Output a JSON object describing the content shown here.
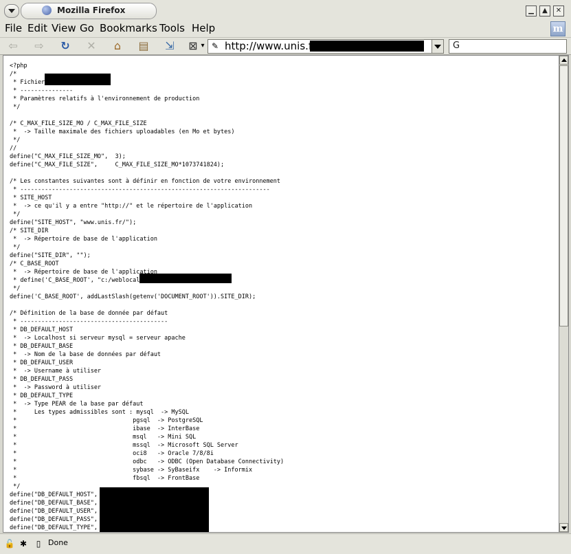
{
  "window": {
    "title": "Mozilla Firefox",
    "min": "▁",
    "max": "▲",
    "close": "✕"
  },
  "menu": {
    "file": "File",
    "edit": "Edit",
    "view": "View",
    "go": "Go",
    "bookmarks": "Bookmarks",
    "tools": "Tools",
    "help": "Help"
  },
  "toolbar": {
    "url": "http://www.unis.fr/"
  },
  "status": {
    "text": "Done"
  },
  "code": {
    "text": "<?php\n/*\n * Fichier\n * ---------------\n * Paramètres relatifs à l'environnement de production\n */\n\n/* C_MAX_FILE_SIZE_MO / C_MAX_FILE_SIZE\n *  -> Taille maximale des fichiers uploadables (en Mo et bytes)\n */\n//\ndefine(\"C_MAX_FILE_SIZE_MO\",  3);\ndefine(\"C_MAX_FILE_SIZE\",     C_MAX_FILE_SIZE_MO*1073741824);\n\n/* Les constantes suivantes sont à définir en fonction de votre environnement\n * -----------------------------------------------------------------------\n * SITE_HOST\n *  -> ce qu'il y a entre \"http://\" et le répertoire de l'application\n */\ndefine(\"SITE_HOST\", \"www.unis.fr/\");\n/* SITE_DIR\n *  -> Répertoire de base de l'application\n */\ndefine(\"SITE_DIR\", \"\");\n/* C_BASE_ROOT\n *  -> Répertoire de base de l'application\n * define('C_BASE_ROOT', \"c:/weblocal/\n */\ndefine('C_BASE_ROOT', addLastSlash(getenv('DOCUMENT_ROOT')).SITE_DIR);\n\n/* Définition de la base de donnée par défaut\n * ------------------------------------------\n * DB_DEFAULT_HOST\n *  -> Localhost si serveur mysql = serveur apache\n * DB_DEFAULT_BASE\n *  -> Nom de la base de données par défaut\n * DB_DEFAULT_USER\n *  -> Username à utiliser\n * DB_DEFAULT_PASS\n *  -> Password à utiliser\n * DB_DEFAULT_TYPE\n *  -> Type PEAR de la base par défaut\n *     Les types admissibles sont : mysql  -> MySQL\n *                                 pgsql  -> PostgreSQL\n *                                 ibase  -> InterBase\n *                                 msql   -> Mini SQL\n *                                 mssql  -> Microsoft SQL Server\n *                                 oci8   -> Oracle 7/8/8i\n *                                 odbc   -> ODBC (Open Database Connectivity)\n *                                 sybase -> SyBaseifx    -> Informix\n *                                 fbsql  -> FrontBase\n */\ndefine(\"DB_DEFAULT_HOST\",\ndefine(\"DB_DEFAULT_BASE\",\ndefine(\"DB_DEFAULT_USER\",\ndefine(\"DB_DEFAULT_PASS\",\ndefine(\"DB_DEFAULT_TYPE\","
  }
}
